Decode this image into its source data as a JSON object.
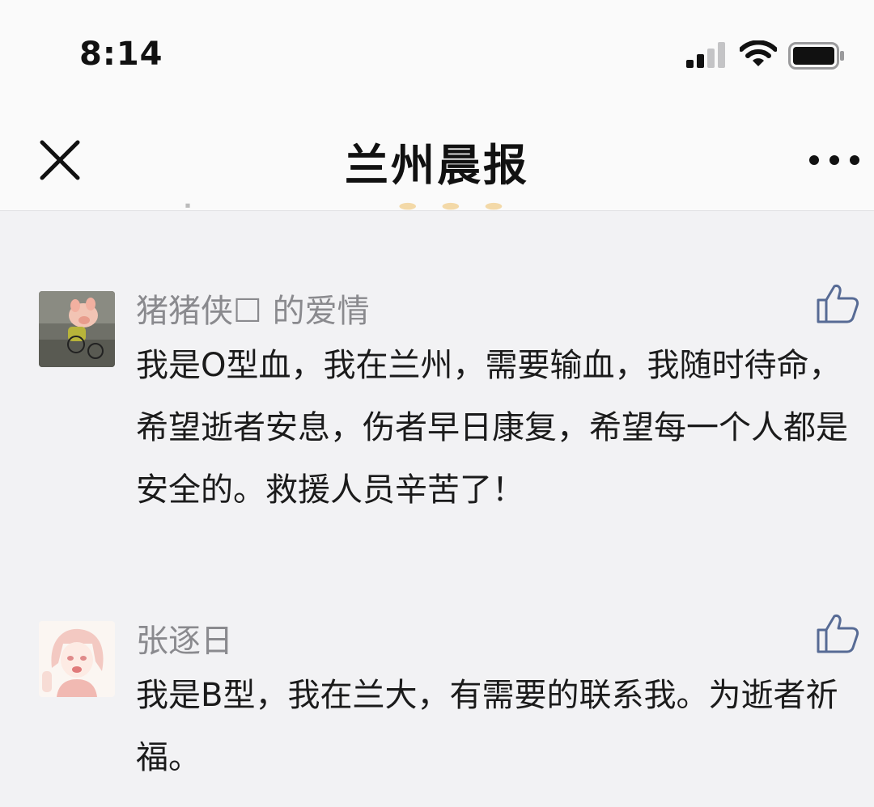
{
  "status_bar": {
    "time": "8:14",
    "icons": [
      "cellular-signal-icon",
      "wifi-icon",
      "battery-icon"
    ]
  },
  "header": {
    "title": "兰州晨报",
    "left_icon": "close-icon",
    "right_icon": "more-icon"
  },
  "comments": [
    {
      "name": "猪猪侠☐ 的爱情",
      "body": "我是O型血，我在兰州，需要输血，我随时待命，希望逝者安息，伤者早日康复，希望每一个人都是安全的。救援人员辛苦了！",
      "avatar": "pig-avatar",
      "like_icon": "thumbs-up-icon"
    },
    {
      "name": "张逐日",
      "body": "我是B型，我在兰大，有需要的联系我。为逝者祈福。",
      "avatar": "anime-girl-avatar",
      "like_icon": "thumbs-up-icon"
    }
  ],
  "colors": {
    "background": "#f2f2f4",
    "header_bg": "#fafafa",
    "name_text": "#8a8a8e",
    "body_text": "#1b1b1b",
    "like_icon": "#576b95"
  }
}
